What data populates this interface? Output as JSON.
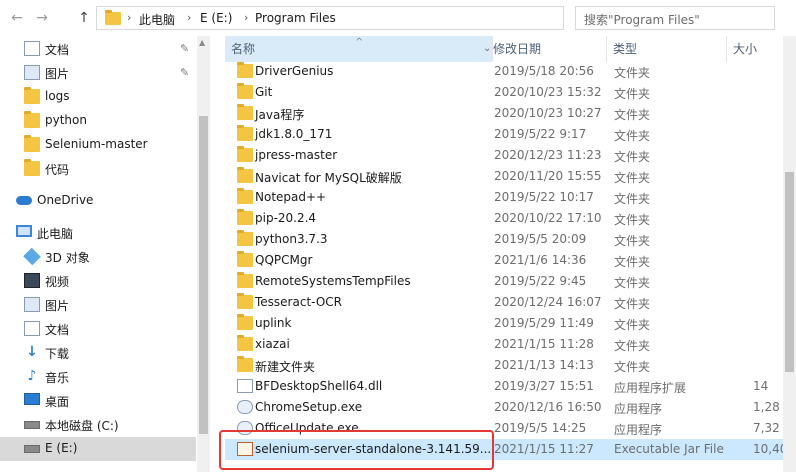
{
  "toolbar": {
    "back_icon": "←",
    "forward_icon": "→",
    "up_icon": "↑"
  },
  "address": {
    "segments": [
      "此电脑",
      "E (E:)",
      "Program Files"
    ],
    "separator": "›"
  },
  "search": {
    "placeholder": "搜索\"Program Files\""
  },
  "sidebar": {
    "items": [
      {
        "label": "文档",
        "icon": "documents-icon",
        "pinned": true
      },
      {
        "label": "图片",
        "icon": "pictures-icon",
        "pinned": true
      },
      {
        "label": "logs",
        "icon": "folder-icon"
      },
      {
        "label": "python",
        "icon": "folder-icon"
      },
      {
        "label": "Selenium-master",
        "icon": "folder-icon"
      },
      {
        "label": "代码",
        "icon": "folder-icon"
      },
      {
        "label": "OneDrive",
        "icon": "cloud-icon"
      },
      {
        "label": "此电脑",
        "icon": "computer-icon"
      },
      {
        "label": "3D 对象",
        "icon": "cube-icon"
      },
      {
        "label": "视频",
        "icon": "video-icon"
      },
      {
        "label": "图片",
        "icon": "pictures-icon"
      },
      {
        "label": "文档",
        "icon": "documents-icon"
      },
      {
        "label": "下载",
        "icon": "download-icon"
      },
      {
        "label": "音乐",
        "icon": "music-icon"
      },
      {
        "label": "桌面",
        "icon": "desktop-icon"
      },
      {
        "label": "本地磁盘 (C:)",
        "icon": "drive-icon"
      },
      {
        "label": "E (E:)",
        "icon": "drive-icon"
      }
    ]
  },
  "columns": {
    "name": "名称",
    "date": "修改日期",
    "type": "类型",
    "size": "大小"
  },
  "files": [
    {
      "name": "DriverGenius",
      "date": "2019/5/18 20:56",
      "type": "文件夹",
      "size": "",
      "kind": "folder"
    },
    {
      "name": "Git",
      "date": "2020/10/23 15:32",
      "type": "文件夹",
      "size": "",
      "kind": "folder"
    },
    {
      "name": "Java程序",
      "date": "2020/10/23 10:27",
      "type": "文件夹",
      "size": "",
      "kind": "folder"
    },
    {
      "name": "jdk1.8.0_171",
      "date": "2019/5/22 9:17",
      "type": "文件夹",
      "size": "",
      "kind": "folder"
    },
    {
      "name": "jpress-master",
      "date": "2020/12/23 11:23",
      "type": "文件夹",
      "size": "",
      "kind": "folder"
    },
    {
      "name": "Navicat for MySQL破解版",
      "date": "2020/11/20 15:55",
      "type": "文件夹",
      "size": "",
      "kind": "folder"
    },
    {
      "name": "Notepad++",
      "date": "2019/5/22 10:17",
      "type": "文件夹",
      "size": "",
      "kind": "folder"
    },
    {
      "name": "pip-20.2.4",
      "date": "2020/10/22 17:10",
      "type": "文件夹",
      "size": "",
      "kind": "folder"
    },
    {
      "name": "python3.7.3",
      "date": "2019/5/5 20:09",
      "type": "文件夹",
      "size": "",
      "kind": "folder"
    },
    {
      "name": "QQPCMgr",
      "date": "2021/1/6 14:36",
      "type": "文件夹",
      "size": "",
      "kind": "folder"
    },
    {
      "name": "RemoteSystemsTempFiles",
      "date": "2019/5/22 9:45",
      "type": "文件夹",
      "size": "",
      "kind": "folder"
    },
    {
      "name": "Tesseract-OCR",
      "date": "2020/12/24 16:07",
      "type": "文件夹",
      "size": "",
      "kind": "folder"
    },
    {
      "name": "uplink",
      "date": "2019/5/29 11:49",
      "type": "文件夹",
      "size": "",
      "kind": "folder"
    },
    {
      "name": "xiazai",
      "date": "2021/1/15 11:28",
      "type": "文件夹",
      "size": "",
      "kind": "folder"
    },
    {
      "name": "新建文件夹",
      "date": "2021/1/13 14:13",
      "type": "文件夹",
      "size": "",
      "kind": "folder"
    },
    {
      "name": "BFDesktopShell64.dll",
      "date": "2019/3/27 15:51",
      "type": "应用程序扩展",
      "size": "14",
      "kind": "dll"
    },
    {
      "name": "ChromeSetup.exe",
      "date": "2020/12/16 16:50",
      "type": "应用程序",
      "size": "1,28",
      "kind": "exe"
    },
    {
      "name": "OfficeUpdate.exe",
      "date": "2019/5/5 14:25",
      "type": "应用程序",
      "size": "7,32",
      "kind": "exe"
    },
    {
      "name": "selenium-server-standalone-3.141.59....",
      "date": "2021/1/15 11:27",
      "type": "Executable Jar File",
      "size": "10,40",
      "kind": "jar",
      "selected": true
    }
  ],
  "colors": {
    "selection": "#cce8ff",
    "header_highlight": "#d9ebf9",
    "folder": "#f4c542",
    "annotation_box": "#e53935"
  }
}
